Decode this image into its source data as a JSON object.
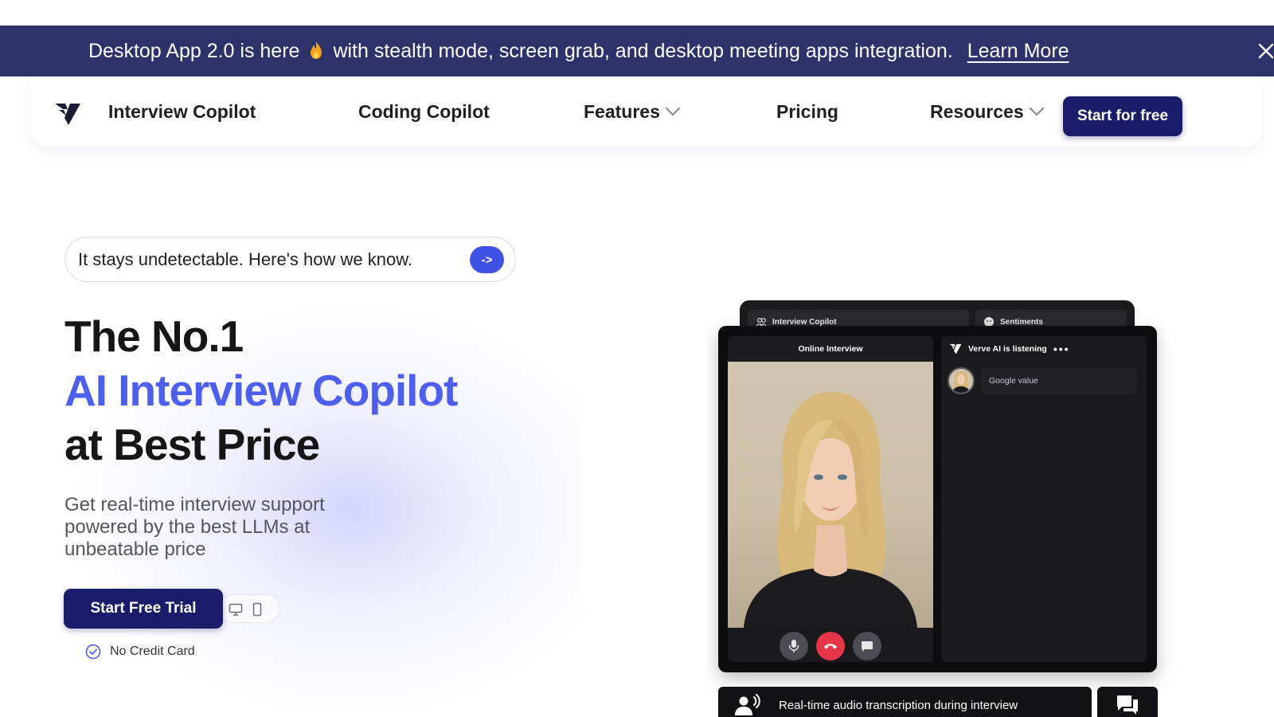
{
  "announcement": {
    "text_before": "Desktop App 2.0 is here",
    "text_after": "with stealth mode, screen grab, and desktop meeting apps integration.",
    "link": "Learn More"
  },
  "nav": {
    "items": [
      {
        "label": "Interview Copilot"
      },
      {
        "label": "Coding Copilot"
      },
      {
        "label": "Features"
      },
      {
        "label": "Pricing"
      },
      {
        "label": "Resources"
      }
    ],
    "cta": "Start for free"
  },
  "hero": {
    "pill_text": "It stays undetectable. Here's how we know.",
    "pill_arrow": "->",
    "title_line1": "The No.1",
    "title_line2": "AI Interview Copilot",
    "title_line3": "at Best Price",
    "subtitle": "Get real-time interview support powered by the best LLMs at unbeatable price",
    "cta": "Start Free Trial",
    "note": "No Credit Card"
  },
  "mockup": {
    "tab1": "Interview Copilot",
    "tab2": "Sentiments",
    "left_title": "Online Interview",
    "right_title": "Verve AI is listening",
    "message": "Google value",
    "caption": "Real-time audio transcription during interview"
  },
  "colors": {
    "announcement_bg": "#2e326b",
    "primary": "#1a1d6b",
    "accent": "#4d5ff0"
  }
}
